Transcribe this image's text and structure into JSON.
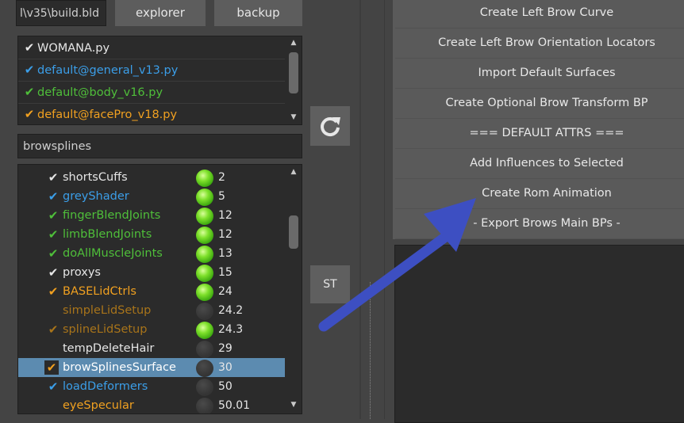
{
  "top": {
    "path_value": "l\\v35\\build.bld",
    "explorer_label": "explorer",
    "backup_label": "backup"
  },
  "files": [
    {
      "name": "WOMANA.py",
      "color": "#e6e6e6",
      "check_color": "#e6e6e6"
    },
    {
      "name": "default@general_v13.py",
      "color": "#3b9ee8",
      "check_color": "#3b9ee8"
    },
    {
      "name": "default@body_v16.py",
      "color": "#4fbf3a",
      "check_color": "#4fbf3a"
    },
    {
      "name": "default@facePro_v18.py",
      "color": "#f0a020",
      "check_color": "#f0a020"
    }
  ],
  "filter_value": "browsplines",
  "refresh_icon": "refresh-icon",
  "st_label": "ST",
  "steps": [
    {
      "name": "shortsCuffs",
      "value": "2",
      "color": "#e6e6e6",
      "checked": true,
      "check_color": "#e6e6e6",
      "active": true
    },
    {
      "name": "greyShader",
      "value": "5",
      "color": "#3b9ee8",
      "checked": true,
      "check_color": "#3b9ee8",
      "active": true
    },
    {
      "name": "fingerBlendJoints",
      "value": "12",
      "color": "#4fbf3a",
      "checked": true,
      "check_color": "#4fbf3a",
      "active": true
    },
    {
      "name": "limbBlendJoints",
      "value": "12",
      "color": "#4fbf3a",
      "checked": true,
      "check_color": "#4fbf3a",
      "active": true
    },
    {
      "name": "doAllMuscleJoints",
      "value": "13",
      "color": "#4fbf3a",
      "checked": true,
      "check_color": "#4fbf3a",
      "active": true
    },
    {
      "name": "proxys",
      "value": "15",
      "color": "#e6e6e6",
      "checked": true,
      "check_color": "#e6e6e6",
      "active": true
    },
    {
      "name": "BASELidCtrls",
      "value": "24",
      "color": "#f0a020",
      "checked": true,
      "check_color": "#f0a020",
      "active": true
    },
    {
      "name": "simpleLidSetup",
      "value": "24.2",
      "color": "#a8741a",
      "checked": false,
      "check_color": "#a8741a",
      "active": false
    },
    {
      "name": "splineLidSetup",
      "value": "24.3",
      "color": "#a8741a",
      "checked": true,
      "check_color": "#a8741a",
      "active": true
    },
    {
      "name": "tempDeleteHair",
      "value": "29",
      "color": "#e6e6e6",
      "checked": false,
      "check_color": "#e6e6e6",
      "active": false
    },
    {
      "name": "browSplinesSurface",
      "value": "30",
      "color": "#ffffff",
      "checked": true,
      "check_color": "#f0a020",
      "active": false,
      "selected": true
    },
    {
      "name": "loadDeformers",
      "value": "50",
      "color": "#3b9ee8",
      "checked": true,
      "check_color": "#3b9ee8",
      "active": false
    },
    {
      "name": "eyeSpecular",
      "value": "50.01",
      "color": "#f0a020",
      "checked": false,
      "check_color": "#f0a020",
      "active": false
    }
  ],
  "actions": [
    "Create Left Brow Curve",
    "Create Left Brow Orientation Locators",
    "Import Default Surfaces",
    "Create Optional Brow Transform BP",
    "=== DEFAULT ATTRS ===",
    "Add Influences to Selected",
    "Create Rom Animation",
    "- Export Brows Main BPs -"
  ],
  "colors": {
    "background": "#444444",
    "accent_selected": "#5c8bb0",
    "annotation_arrow": "#3d4fc2"
  }
}
